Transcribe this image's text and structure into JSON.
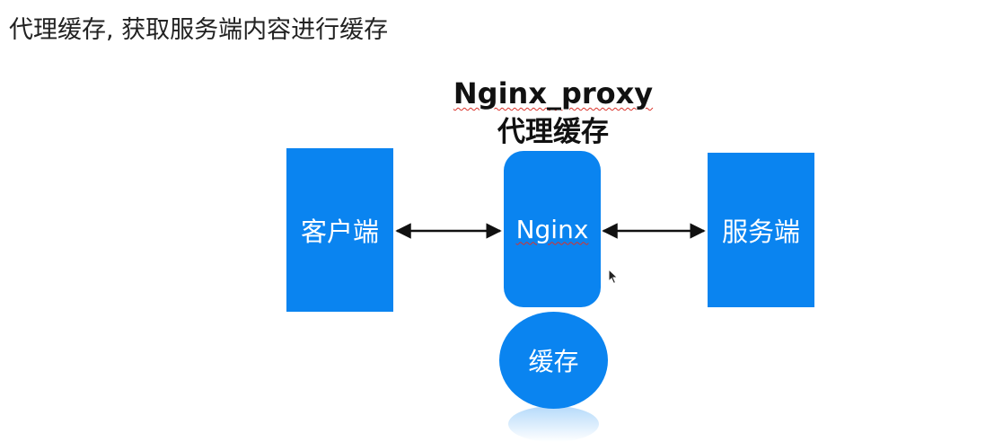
{
  "page": {
    "heading": "代理缓存, 获取服务端内容进行缓存"
  },
  "diagram": {
    "title_line1": "Nginx_proxy",
    "title_line2": "代理缓存",
    "client_label": "客户端",
    "nginx_label": "Nginx",
    "server_label": "服务端",
    "cache_label": "缓存",
    "colors": {
      "node_fill": "#0a84f0",
      "node_text": "#ffffff",
      "arrow": "#111111",
      "spellcheck_underline": "#d9322a"
    }
  },
  "icons": {
    "cursor": "mouse-pointer-icon",
    "arrow_left": "arrow-bidirectional-icon",
    "arrow_right": "arrow-bidirectional-icon"
  }
}
